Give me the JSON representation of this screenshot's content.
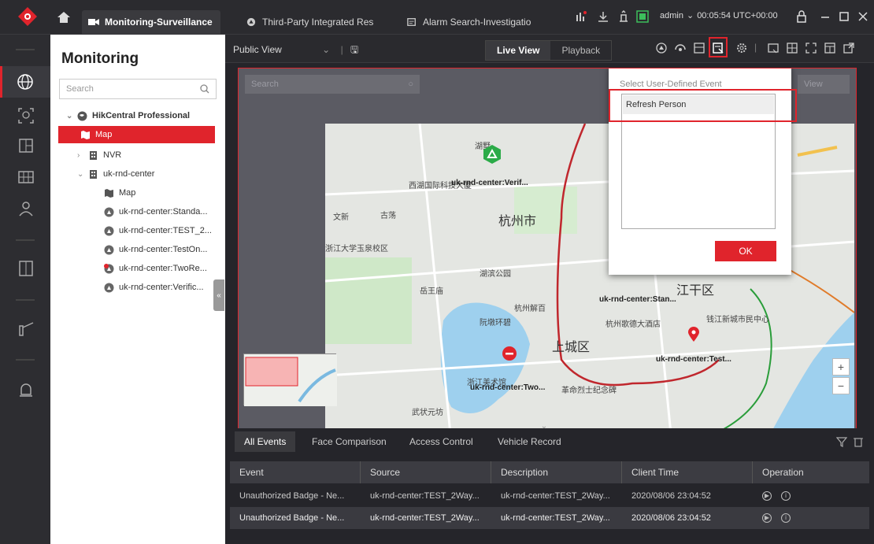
{
  "tabs": [
    {
      "label": "Monitoring-Surveillance",
      "active": true,
      "icon": "video-icon"
    },
    {
      "label": "Third-Party Integrated Res",
      "active": false,
      "icon": "integration-icon"
    },
    {
      "label": "Alarm Search-Investigatio",
      "active": false,
      "icon": "alarm-search-icon"
    }
  ],
  "user": {
    "name": "admin",
    "time": "00:05:54 UTC+00:00"
  },
  "tree": {
    "title": "Monitoring",
    "search_placeholder": "Search",
    "nodes": [
      {
        "label": "HikCentral Professional",
        "icon": "globe-icon"
      },
      {
        "label": "Map",
        "icon": "map-icon",
        "selected": true
      },
      {
        "label": "NVR",
        "icon": "building-icon"
      },
      {
        "label": "uk-rnd-center",
        "icon": "building-icon"
      },
      {
        "label": "Map",
        "icon": "map-icon"
      },
      {
        "label": "uk-rnd-center:Standa...",
        "icon": "door-icon"
      },
      {
        "label": "uk-rnd-center:TEST_2...",
        "icon": "door-icon"
      },
      {
        "label": "uk-rnd-center:TestOn...",
        "icon": "door-icon"
      },
      {
        "label": "uk-rnd-center:TwoRe...",
        "icon": "door-alert-icon"
      },
      {
        "label": "uk-rnd-center:Verific...",
        "icon": "door-icon"
      }
    ]
  },
  "viewbar": {
    "view_name": "Public View",
    "live": "Live View",
    "playback": "Playback"
  },
  "map": {
    "search_placeholder": "Search",
    "view_label": "View",
    "labels": [
      "uk-rnd-center:Verif...",
      "uk-rnd-center:Stan...",
      "uk-rnd-center:Test...",
      "uk-rnd-center:Two..."
    ],
    "city_names": [
      "杭州市",
      "上城区",
      "江干区"
    ],
    "places": [
      "西湖国际科技大厦",
      "浙江大学玉泉校区",
      "湖滨公园",
      "岳王庙",
      "杭州解百",
      "阮墩环碧",
      "杭州歌德大酒店",
      "钱江新城市民中心",
      "革命烈士纪念碑",
      "武状元坊",
      "浙江美术馆"
    ]
  },
  "popup": {
    "title": "Select User-Defined Event",
    "item": "Refresh Person",
    "ok": "OK"
  },
  "events": {
    "tabs": [
      "All Events",
      "Face Comparison",
      "Access Control",
      "Vehicle Record"
    ],
    "columns": [
      "Event",
      "Source",
      "Description",
      "Client Time",
      "Operation"
    ],
    "rows": [
      [
        "Unauthorized Badge - Ne...",
        "uk-rnd-center:TEST_2Way...",
        "uk-rnd-center:TEST_2Way...",
        "2020/08/06 23:04:52"
      ],
      [
        "Unauthorized Badge - Ne...",
        "uk-rnd-center:TEST_2Way...",
        "uk-rnd-center:TEST_2Way...",
        "2020/08/06 23:04:52"
      ]
    ]
  },
  "colors": {
    "accent": "#e0242c",
    "dark_bg": "#1f1f22",
    "panel": "#2b2b2f"
  }
}
